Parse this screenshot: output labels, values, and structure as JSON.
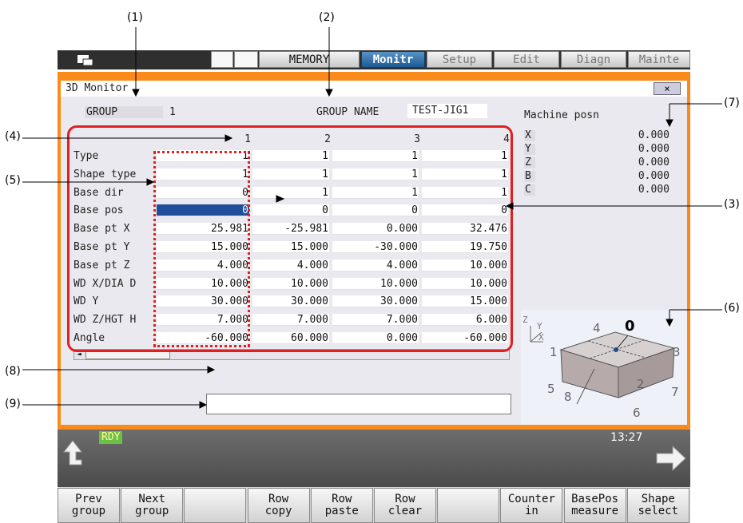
{
  "callouts": [
    "(1)",
    "(2)",
    "(3)",
    "(4)",
    "(5)",
    "(6)",
    "(7)",
    "(8)",
    "(9)"
  ],
  "topbar": {
    "tabs": [
      {
        "label": "MEMORY",
        "state": "normal"
      },
      {
        "label": "Monitr",
        "state": "active"
      },
      {
        "label": "Setup",
        "state": "dim"
      },
      {
        "label": "Edit",
        "state": "dim"
      },
      {
        "label": "Diagn",
        "state": "dim"
      },
      {
        "label": "Mainte",
        "state": "dim"
      }
    ]
  },
  "window": {
    "title": "3D Monitor",
    "close_label": "×",
    "group_label": "GROUP",
    "group_value": "1",
    "group_name_label": "GROUP NAME",
    "group_name_value": "TEST-JIG1"
  },
  "table": {
    "columns": [
      "1",
      "2",
      "3",
      "4"
    ],
    "rows": [
      {
        "label": "Type",
        "values": [
          "1",
          "1",
          "1",
          "1"
        ]
      },
      {
        "label": "Shape type",
        "values": [
          "1",
          "1",
          "1",
          "1"
        ]
      },
      {
        "label": "Base dir",
        "values": [
          "0",
          "1",
          "1",
          "1"
        ]
      },
      {
        "label": "Base pos",
        "values": [
          "0",
          "0",
          "0",
          "0"
        ]
      },
      {
        "label": "Base pt X",
        "values": [
          "25.981",
          "-25.981",
          "0.000",
          "32.476"
        ]
      },
      {
        "label": "Base pt Y",
        "values": [
          "15.000",
          "15.000",
          "-30.000",
          "19.750"
        ]
      },
      {
        "label": "Base pt Z",
        "values": [
          "4.000",
          "4.000",
          "4.000",
          "10.000"
        ]
      },
      {
        "label": "WD X/DIA D",
        "values": [
          "10.000",
          "10.000",
          "10.000",
          "10.000"
        ]
      },
      {
        "label": "WD Y",
        "values": [
          "30.000",
          "30.000",
          "30.000",
          "15.000"
        ]
      },
      {
        "label": "WD Z/HGT H",
        "values": [
          "7.000",
          "7.000",
          "7.000",
          "6.000"
        ]
      },
      {
        "label": "Angle",
        "values": [
          "-60.000",
          "60.000",
          "0.000",
          "-60.000"
        ]
      }
    ],
    "selected_cell": "Base pos / 1"
  },
  "machine_posn": {
    "title": "Machine posn",
    "axes": [
      {
        "axis": "X",
        "value": "0.000"
      },
      {
        "axis": "Y",
        "value": "0.000"
      },
      {
        "axis": "Z",
        "value": "0.000"
      },
      {
        "axis": "B",
        "value": "0.000"
      },
      {
        "axis": "C",
        "value": "0.000"
      }
    ]
  },
  "shape_diagram": {
    "axis_labels": [
      "Z",
      "Y",
      "X"
    ],
    "vertex_labels": [
      "0",
      "1",
      "2",
      "3",
      "4",
      "5",
      "6",
      "7",
      "8"
    ]
  },
  "status": {
    "state": "RDY",
    "time": "13:27"
  },
  "function_keys": [
    {
      "line1": "Prev",
      "line2": "group"
    },
    {
      "line1": "Next",
      "line2": "group"
    },
    {
      "line1": "",
      "line2": ""
    },
    {
      "line1": "Row",
      "line2": "copy"
    },
    {
      "line1": "Row",
      "line2": "paste"
    },
    {
      "line1": "Row",
      "line2": "clear"
    },
    {
      "line1": "",
      "line2": ""
    },
    {
      "line1": "Counter",
      "line2": "in"
    },
    {
      "line1": "BasePos",
      "line2": "measure"
    },
    {
      "line1": "Shape",
      "line2": "select"
    }
  ],
  "colors": {
    "window_border": "#fa8a1a",
    "active_tab": "#1c5a94",
    "highlight_red": "#e02020",
    "ready_badge": "#6cc04a"
  }
}
